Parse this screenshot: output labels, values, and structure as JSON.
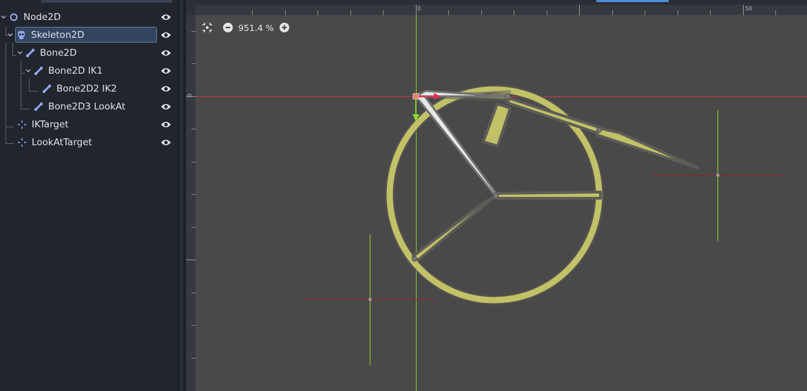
{
  "scene_tree": {
    "nodes": [
      {
        "label": "Node2D",
        "icon": "node2d-circle-icon"
      },
      {
        "label": "Skeleton2D",
        "icon": "skeleton-skull-icon",
        "selected": true
      },
      {
        "label": "Bone2D",
        "icon": "bone-icon"
      },
      {
        "label": "Bone2D IK1",
        "icon": "bone-icon"
      },
      {
        "label": "Bone2D2 IK2",
        "icon": "bone-icon"
      },
      {
        "label": "Bone2D3 LookAt",
        "icon": "bone-icon"
      },
      {
        "label": "IKTarget",
        "icon": "position2d-icon"
      },
      {
        "label": "LookAtTarget",
        "icon": "position2d-icon"
      }
    ]
  },
  "viewport": {
    "zoom_value": "951.4 %",
    "ruler_top": [
      "0",
      "50"
    ],
    "ruler_left": [
      "0"
    ]
  },
  "colors": {
    "panel_bg": "#21262e",
    "viewport_bg": "#494949",
    "bone_fill": "#c8c76c",
    "x_axis": "#cc3344",
    "y_axis": "#77cc33",
    "selection": "#33465f"
  }
}
